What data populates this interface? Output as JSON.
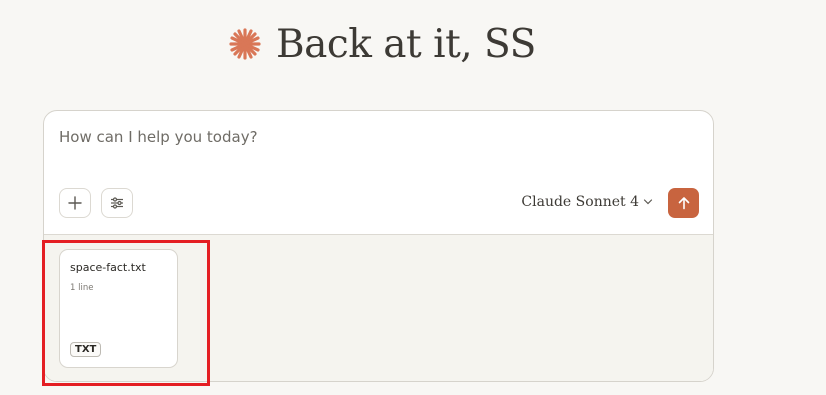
{
  "header": {
    "greeting": "Back at it, SS",
    "logo_icon": "spark-icon",
    "logo_color": "#d97757"
  },
  "composer": {
    "placeholder": "How can I help you today?",
    "add_icon": "plus-icon",
    "tools_icon": "sliders-icon",
    "model_label": "Claude Sonnet 4",
    "model_icon": "chevron-down-icon",
    "send_icon": "arrow-up-icon",
    "send_color": "#c8643f"
  },
  "attachments": [
    {
      "name": "space-fact.txt",
      "lines": "1 line",
      "type": "TXT"
    }
  ],
  "annotation": {
    "highlight_color": "#e41e23"
  }
}
